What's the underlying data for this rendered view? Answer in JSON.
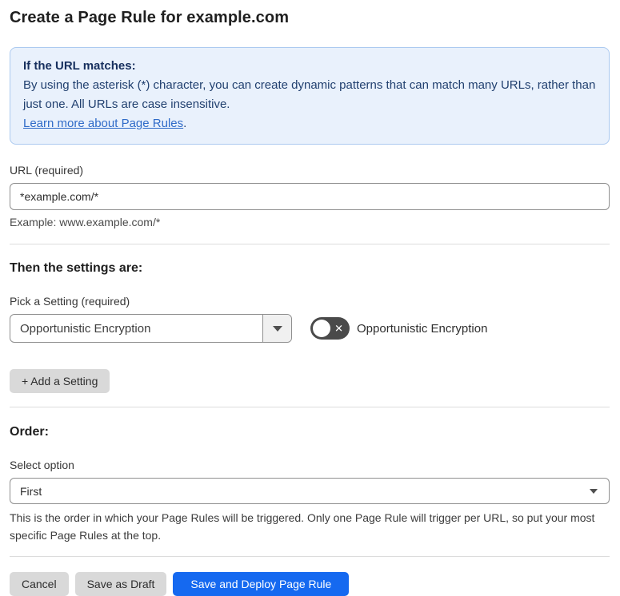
{
  "page": {
    "title": "Create a Page Rule for example.com"
  },
  "info_box": {
    "heading": "If the URL matches:",
    "body": "By using the asterisk (*) character, you can create dynamic patterns that can match many URLs, rather than just one. All URLs are case insensitive.",
    "link_label": "Learn more about Page Rules",
    "link_suffix": "."
  },
  "url_field": {
    "label": "URL (required)",
    "value": "*example.com/*",
    "example": "Example: www.example.com/*"
  },
  "settings_section": {
    "heading": "Then the settings are:",
    "picker_label": "Pick a Setting (required)",
    "selected_setting": "Opportunistic Encryption",
    "toggle": {
      "state": "off",
      "label": "Opportunistic Encryption",
      "off_glyph": "✕"
    },
    "add_button_label": "+ Add a Setting"
  },
  "order_section": {
    "heading": "Order:",
    "label": "Select option",
    "selected_option": "First",
    "help": "This is the order in which your Page Rules will be triggered. Only one Page Rule will trigger per URL, so put your most specific Page Rules at the top."
  },
  "actions": {
    "cancel_label": "Cancel",
    "save_draft_label": "Save as Draft",
    "save_deploy_label": "Save and Deploy Page Rule"
  },
  "colors": {
    "accent_blue": "#1569f0",
    "info_background": "#e9f1fc",
    "info_border": "#abc9f0",
    "info_text": "#1e3a6d",
    "link_blue": "#2f6bc8",
    "toggle_off_background": "#4a4a4a",
    "gray_button": "#d9d9d9"
  }
}
